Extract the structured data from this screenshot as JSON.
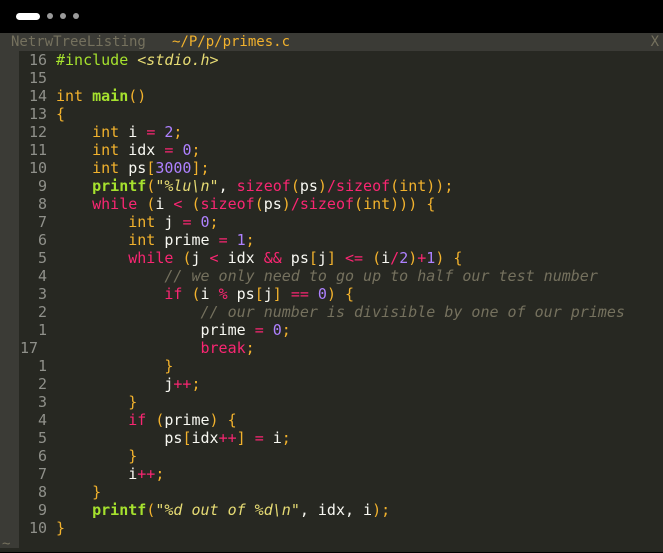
{
  "window": {
    "controls": [
      "pill",
      "dot",
      "dot",
      "dot"
    ]
  },
  "tabline": {
    "inactive_tab": "NetrwTreeListing",
    "active_tab": "~/P/p/primes.c",
    "close_label": "X"
  },
  "colors": {
    "background": "#272822",
    "foreground": "#f8f8f2",
    "keyword": "#f92672",
    "type": "#f2b22d",
    "function": "#a6e22e",
    "string": "#e6db74",
    "number": "#ae81ff",
    "comment": "#75715e",
    "preproc": "#a6e22e",
    "gutter": "#3b3b36",
    "line_number": "#8f908a"
  },
  "editor": {
    "end_marker": "~",
    "lines": [
      {
        "num": "16",
        "segments": [
          {
            "t": "#include ",
            "c": "preproc"
          },
          {
            "t": "<stdio.h>",
            "c": "string",
            "i": true
          }
        ]
      },
      {
        "num": "15",
        "segments": []
      },
      {
        "num": "14",
        "segments": [
          {
            "t": "int",
            "c": "type"
          },
          {
            "t": " "
          },
          {
            "t": "main",
            "c": "function",
            "b": true
          },
          {
            "t": "()",
            "c": "type"
          }
        ]
      },
      {
        "num": "13",
        "segments": [
          {
            "t": "{",
            "c": "type"
          }
        ]
      },
      {
        "num": "12",
        "segments": [
          {
            "t": "    "
          },
          {
            "t": "int",
            "c": "type"
          },
          {
            "t": " i "
          },
          {
            "t": "=",
            "c": "keyword"
          },
          {
            "t": " "
          },
          {
            "t": "2",
            "c": "number"
          },
          {
            "t": ";",
            "c": "type"
          }
        ]
      },
      {
        "num": "11",
        "segments": [
          {
            "t": "    "
          },
          {
            "t": "int",
            "c": "type"
          },
          {
            "t": " idx "
          },
          {
            "t": "=",
            "c": "keyword"
          },
          {
            "t": " "
          },
          {
            "t": "0",
            "c": "number"
          },
          {
            "t": ";",
            "c": "type"
          }
        ]
      },
      {
        "num": "10",
        "segments": [
          {
            "t": "    "
          },
          {
            "t": "int",
            "c": "type"
          },
          {
            "t": " ps"
          },
          {
            "t": "[",
            "c": "type"
          },
          {
            "t": "3000",
            "c": "number"
          },
          {
            "t": "];",
            "c": "type"
          }
        ]
      },
      {
        "num": "9",
        "segments": [
          {
            "t": "    "
          },
          {
            "t": "printf",
            "c": "function",
            "b": true
          },
          {
            "t": "(",
            "c": "type"
          },
          {
            "t": "\"",
            "c": "string"
          },
          {
            "t": "%lu\\n",
            "c": "string",
            "i": true
          },
          {
            "t": "\"",
            "c": "string"
          },
          {
            "t": ", "
          },
          {
            "t": "sizeof",
            "c": "keyword"
          },
          {
            "t": "(",
            "c": "type"
          },
          {
            "t": "ps"
          },
          {
            "t": ")",
            "c": "type"
          },
          {
            "t": "/",
            "c": "keyword"
          },
          {
            "t": "sizeof",
            "c": "keyword"
          },
          {
            "t": "(",
            "c": "type"
          },
          {
            "t": "int",
            "c": "type"
          },
          {
            "t": "));",
            "c": "type"
          }
        ]
      },
      {
        "num": "8",
        "segments": [
          {
            "t": "    "
          },
          {
            "t": "while",
            "c": "keyword"
          },
          {
            "t": " "
          },
          {
            "t": "(",
            "c": "type"
          },
          {
            "t": "i "
          },
          {
            "t": "<",
            "c": "keyword"
          },
          {
            "t": " "
          },
          {
            "t": "(",
            "c": "type"
          },
          {
            "t": "sizeof",
            "c": "keyword"
          },
          {
            "t": "(",
            "c": "type"
          },
          {
            "t": "ps"
          },
          {
            "t": ")",
            "c": "type"
          },
          {
            "t": "/",
            "c": "keyword"
          },
          {
            "t": "sizeof",
            "c": "keyword"
          },
          {
            "t": "(",
            "c": "type"
          },
          {
            "t": "int",
            "c": "type"
          },
          {
            "t": "))) {",
            "c": "type"
          }
        ]
      },
      {
        "num": "7",
        "segments": [
          {
            "t": "        "
          },
          {
            "t": "int",
            "c": "type"
          },
          {
            "t": " j "
          },
          {
            "t": "=",
            "c": "keyword"
          },
          {
            "t": " "
          },
          {
            "t": "0",
            "c": "number"
          },
          {
            "t": ";",
            "c": "type"
          }
        ]
      },
      {
        "num": "6",
        "segments": [
          {
            "t": "        "
          },
          {
            "t": "int",
            "c": "type"
          },
          {
            "t": " prime "
          },
          {
            "t": "=",
            "c": "keyword"
          },
          {
            "t": " "
          },
          {
            "t": "1",
            "c": "number"
          },
          {
            "t": ";",
            "c": "type"
          }
        ]
      },
      {
        "num": "5",
        "segments": [
          {
            "t": "        "
          },
          {
            "t": "while",
            "c": "keyword"
          },
          {
            "t": " "
          },
          {
            "t": "(",
            "c": "type"
          },
          {
            "t": "j "
          },
          {
            "t": "<",
            "c": "keyword"
          },
          {
            "t": " idx "
          },
          {
            "t": "&&",
            "c": "keyword"
          },
          {
            "t": " ps"
          },
          {
            "t": "[",
            "c": "type"
          },
          {
            "t": "j"
          },
          {
            "t": "]",
            "c": "type"
          },
          {
            "t": " "
          },
          {
            "t": "<=",
            "c": "keyword"
          },
          {
            "t": " "
          },
          {
            "t": "(",
            "c": "type"
          },
          {
            "t": "i"
          },
          {
            "t": "/",
            "c": "keyword"
          },
          {
            "t": "2",
            "c": "number"
          },
          {
            "t": ")",
            "c": "type"
          },
          {
            "t": "+",
            "c": "keyword"
          },
          {
            "t": "1",
            "c": "number"
          },
          {
            "t": ") {",
            "c": "type"
          }
        ]
      },
      {
        "num": "4",
        "segments": [
          {
            "t": "            "
          },
          {
            "t": "// we only need to go up to half our test number",
            "c": "comment",
            "i": true
          }
        ]
      },
      {
        "num": "3",
        "segments": [
          {
            "t": "            "
          },
          {
            "t": "if",
            "c": "keyword"
          },
          {
            "t": " "
          },
          {
            "t": "(",
            "c": "type"
          },
          {
            "t": "i "
          },
          {
            "t": "%",
            "c": "keyword"
          },
          {
            "t": " ps"
          },
          {
            "t": "[",
            "c": "type"
          },
          {
            "t": "j"
          },
          {
            "t": "]",
            "c": "type"
          },
          {
            "t": " "
          },
          {
            "t": "==",
            "c": "keyword"
          },
          {
            "t": " "
          },
          {
            "t": "0",
            "c": "number"
          },
          {
            "t": ") {",
            "c": "type"
          }
        ]
      },
      {
        "num": "2",
        "segments": [
          {
            "t": "                "
          },
          {
            "t": "// our number is divisible by one of our primes",
            "c": "comment",
            "i": true
          }
        ]
      },
      {
        "num": "1",
        "segments": [
          {
            "t": "                "
          },
          {
            "t": "prime "
          },
          {
            "t": "=",
            "c": "keyword"
          },
          {
            "t": " "
          },
          {
            "t": "0",
            "c": "number"
          },
          {
            "t": ";",
            "c": "type"
          }
        ]
      },
      {
        "num": "17",
        "current": true,
        "segments": [
          {
            "t": "                "
          },
          {
            "t": "break",
            "c": "keyword"
          },
          {
            "t": ";",
            "c": "type"
          }
        ]
      },
      {
        "num": "1",
        "segments": [
          {
            "t": "            "
          },
          {
            "t": "}",
            "c": "type"
          }
        ]
      },
      {
        "num": "2",
        "segments": [
          {
            "t": "            "
          },
          {
            "t": "j"
          },
          {
            "t": "++",
            "c": "keyword"
          },
          {
            "t": ";",
            "c": "type"
          }
        ]
      },
      {
        "num": "3",
        "segments": [
          {
            "t": "        "
          },
          {
            "t": "}",
            "c": "type"
          }
        ]
      },
      {
        "num": "4",
        "segments": [
          {
            "t": "        "
          },
          {
            "t": "if",
            "c": "keyword"
          },
          {
            "t": " "
          },
          {
            "t": "(",
            "c": "type"
          },
          {
            "t": "prime"
          },
          {
            "t": ") {",
            "c": "type"
          }
        ]
      },
      {
        "num": "5",
        "segments": [
          {
            "t": "            "
          },
          {
            "t": "ps"
          },
          {
            "t": "[",
            "c": "type"
          },
          {
            "t": "idx"
          },
          {
            "t": "++",
            "c": "keyword"
          },
          {
            "t": "]",
            "c": "type"
          },
          {
            "t": " "
          },
          {
            "t": "=",
            "c": "keyword"
          },
          {
            "t": " i"
          },
          {
            "t": ";",
            "c": "type"
          }
        ]
      },
      {
        "num": "6",
        "segments": [
          {
            "t": "        "
          },
          {
            "t": "}",
            "c": "type"
          }
        ]
      },
      {
        "num": "7",
        "segments": [
          {
            "t": "        "
          },
          {
            "t": "i"
          },
          {
            "t": "++",
            "c": "keyword"
          },
          {
            "t": ";",
            "c": "type"
          }
        ]
      },
      {
        "num": "8",
        "segments": [
          {
            "t": "    "
          },
          {
            "t": "}",
            "c": "type"
          }
        ]
      },
      {
        "num": "9",
        "segments": [
          {
            "t": "    "
          },
          {
            "t": "printf",
            "c": "function",
            "b": true
          },
          {
            "t": "(",
            "c": "type"
          },
          {
            "t": "\"",
            "c": "string"
          },
          {
            "t": "%d out of %d\\n",
            "c": "string",
            "i": true
          },
          {
            "t": "\"",
            "c": "string"
          },
          {
            "t": ", idx, i"
          },
          {
            "t": ");",
            "c": "type"
          }
        ]
      },
      {
        "num": "10",
        "segments": [
          {
            "t": "}",
            "c": "type"
          }
        ]
      }
    ]
  }
}
